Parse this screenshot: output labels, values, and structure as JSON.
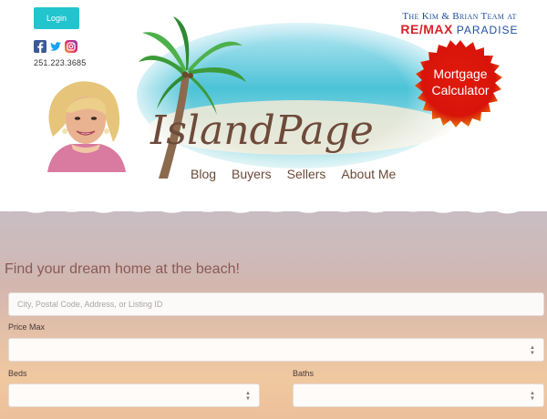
{
  "header": {
    "login_label": "Login",
    "phone": "251.223.3685",
    "social_icons": [
      "facebook-icon",
      "twitter-icon",
      "instagram-icon"
    ],
    "site_title": "IslandPage",
    "team_line": "The Kim & Brian Team at",
    "brand_remax": "RE/MAX",
    "brand_paradise": "PARADISE",
    "mortgage_line1": "Mortgage",
    "mortgage_line2": "Calculator",
    "nav": [
      "Blog",
      "Buyers",
      "Sellers",
      "About Me"
    ]
  },
  "search": {
    "headline": "Find your dream home at the beach!",
    "placeholder": "City, Postal Code, Address, or Listing ID",
    "price_max_label": "Price Max",
    "price_max_value": "",
    "beds_label": "Beds",
    "beds_value": "",
    "baths_label": "Baths",
    "baths_value": ""
  },
  "colors": {
    "login_bg": "#22c4ce",
    "nav_text": "#6b4a39",
    "headline_text": "#8a5a55",
    "remax_red": "#d8232a",
    "remax_blue": "#1f4e9c",
    "badge_red": "#e0180e"
  }
}
